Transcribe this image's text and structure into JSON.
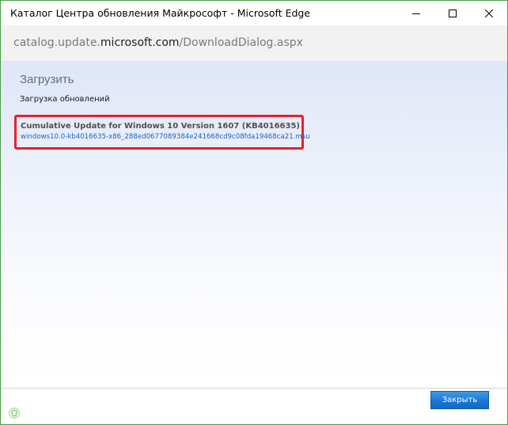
{
  "window": {
    "title": "Каталог Центра обновления Майкрософт - Microsoft Edge",
    "minimize_icon": "minimize-icon",
    "maximize_icon": "maximize-icon",
    "close_icon": "close-icon"
  },
  "address": {
    "prefix": "catalog.update.",
    "domain": "microsoft.com",
    "path": "/DownloadDialog.aspx"
  },
  "page": {
    "title": "Загрузить",
    "subtitle": "Загрузка обновлений"
  },
  "update": {
    "title": "Cumulative Update for Windows 10 Version 1607 (KB4016635)",
    "file_link": "windows10.0-kb4016635-x86_288ed0677089384e241668cd9c08fda19468ca21.msu"
  },
  "footer": {
    "close_label": "Закрыть",
    "shield_icon": "shield-icon"
  },
  "colors": {
    "highlight": "#e8202e",
    "link": "#1c66c8",
    "button": "#1a78d6",
    "window_border": "#46a046"
  }
}
